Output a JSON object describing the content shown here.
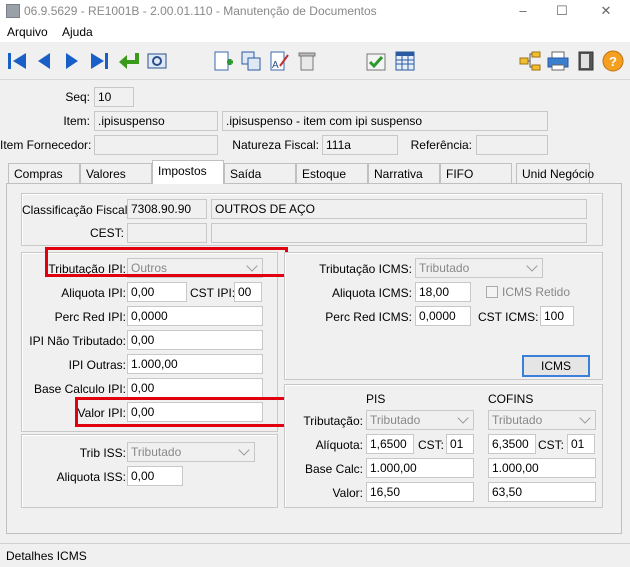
{
  "window": {
    "title": "06.9.5629 - RE1001B - 2.00.01.110 - Manutenção de Documentos"
  },
  "menu": [
    "Arquivo",
    "Ajuda"
  ],
  "header": {
    "seq_label": "Seq:",
    "seq_value": "10",
    "item_label": "Item:",
    "item_code": ".ipisuspenso",
    "item_desc": ".ipisuspenso - item com ipi suspenso",
    "fornecedor_label": "Item Fornecedor:",
    "fornecedor_value": "",
    "natureza_label": "Natureza Fiscal:",
    "natureza_value": "111a",
    "referencia_label": "Referência:",
    "referencia_value": ""
  },
  "tabs": [
    "Compras",
    "Valores",
    "Impostos",
    "Saída",
    "Estoque",
    "Narrativa",
    "FIFO",
    "Unid Negócio"
  ],
  "active_tab": "Impostos",
  "classificacao": {
    "class_label": "Classificação Fiscal:",
    "class_code": "7308.90.90",
    "class_desc": "OUTROS DE AÇO",
    "cest_label": "CEST:",
    "cest_value": ""
  },
  "ipi": {
    "trib_label": "Tributação IPI:",
    "trib_value": "Outros",
    "aliq_label": "Aliquota IPI:",
    "aliq_value": "0,00",
    "cst_label": "CST IPI:",
    "cst_value": "00",
    "perc_label": "Perc Red IPI:",
    "perc_value": "0,0000",
    "naotrib_label": "IPI Não Tributado:",
    "naotrib_value": "0,00",
    "outras_label": "IPI Outras:",
    "outras_value": "1.000,00",
    "base_label": "Base Calculo IPI:",
    "base_value": "0,00",
    "valor_label": "Valor IPI:",
    "valor_value": "0,00"
  },
  "iss": {
    "trib_label": "Trib ISS:",
    "trib_value": "Tributado",
    "aliq_label": "Aliquota ISS:",
    "aliq_value": "0,00"
  },
  "icms": {
    "trib_label": "Tributação ICMS:",
    "trib_value": "Tributado",
    "aliq_label": "Aliquota ICMS:",
    "aliq_value": "18,00",
    "retido_label": "ICMS Retido",
    "perc_label": "Perc Red ICMS:",
    "perc_value": "0,0000",
    "cst_label": "CST ICMS:",
    "cst_value": "100",
    "button_label": "ICMS"
  },
  "pis_cofins": {
    "pis_header": "PIS",
    "cofins_header": "COFINS",
    "trib_label": "Tributação:",
    "pis_trib": "Tributado",
    "cofins_trib": "Tributado",
    "aliq_label": "Alíquota:",
    "pis_aliq": "1,6500",
    "cofins_aliq": "6,3500",
    "cst_label": "CST:",
    "pis_cst": "01",
    "cofins_cst": "01",
    "base_label": "Base Calc:",
    "pis_base": "1.000,00",
    "cofins_base": "1.000,00",
    "valor_label": "Valor:",
    "pis_valor": "16,50",
    "cofins_valor": "63,50"
  },
  "status": {
    "text": "Detalhes ICMS"
  }
}
